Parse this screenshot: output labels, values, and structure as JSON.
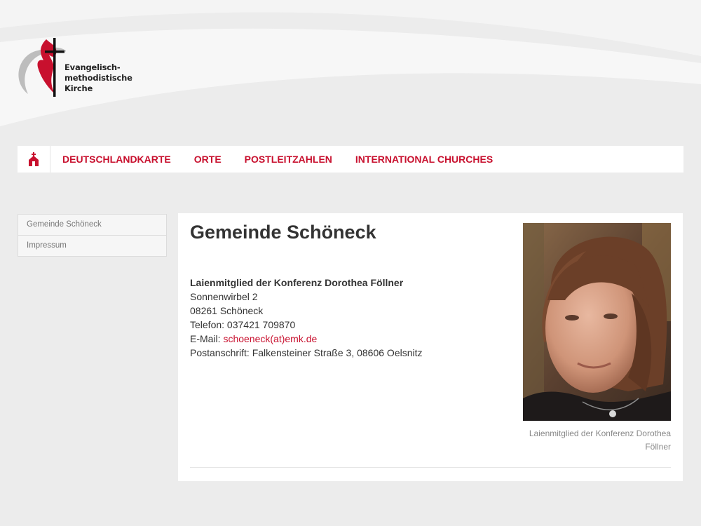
{
  "logo": {
    "line1": "Evangelisch-",
    "line2": "methodistische",
    "line3": "Kirche"
  },
  "nav": {
    "home_icon": "church-icon",
    "items": [
      {
        "label": "DEUTSCHLANDKARTE"
      },
      {
        "label": "ORTE"
      },
      {
        "label": "POSTLEITZAHLEN"
      },
      {
        "label": "INTERNATIONAL CHURCHES"
      }
    ]
  },
  "sidebar": {
    "items": [
      {
        "label": "Gemeinde Schöneck"
      },
      {
        "label": "Impressum"
      }
    ]
  },
  "main": {
    "title": "Gemeinde Schöneck",
    "contact": {
      "name": "Laienmitglied der Konferenz Dorothea Föllner",
      "street": "Sonnenwirbel 2",
      "city": "08261 Schöneck",
      "phone": "Telefon: 037421 709870",
      "email_prefix": "E-Mail: ",
      "email": "schoeneck(at)emk.de",
      "postal": "Postanschrift: Falkensteiner Straße 3, 08606 Oelsnitz"
    },
    "photo_caption": "Laienmitglied der Konferenz Dorothea Föllner"
  },
  "colors": {
    "accent": "#c8102e",
    "background": "#ececec",
    "panel": "#ffffff"
  }
}
